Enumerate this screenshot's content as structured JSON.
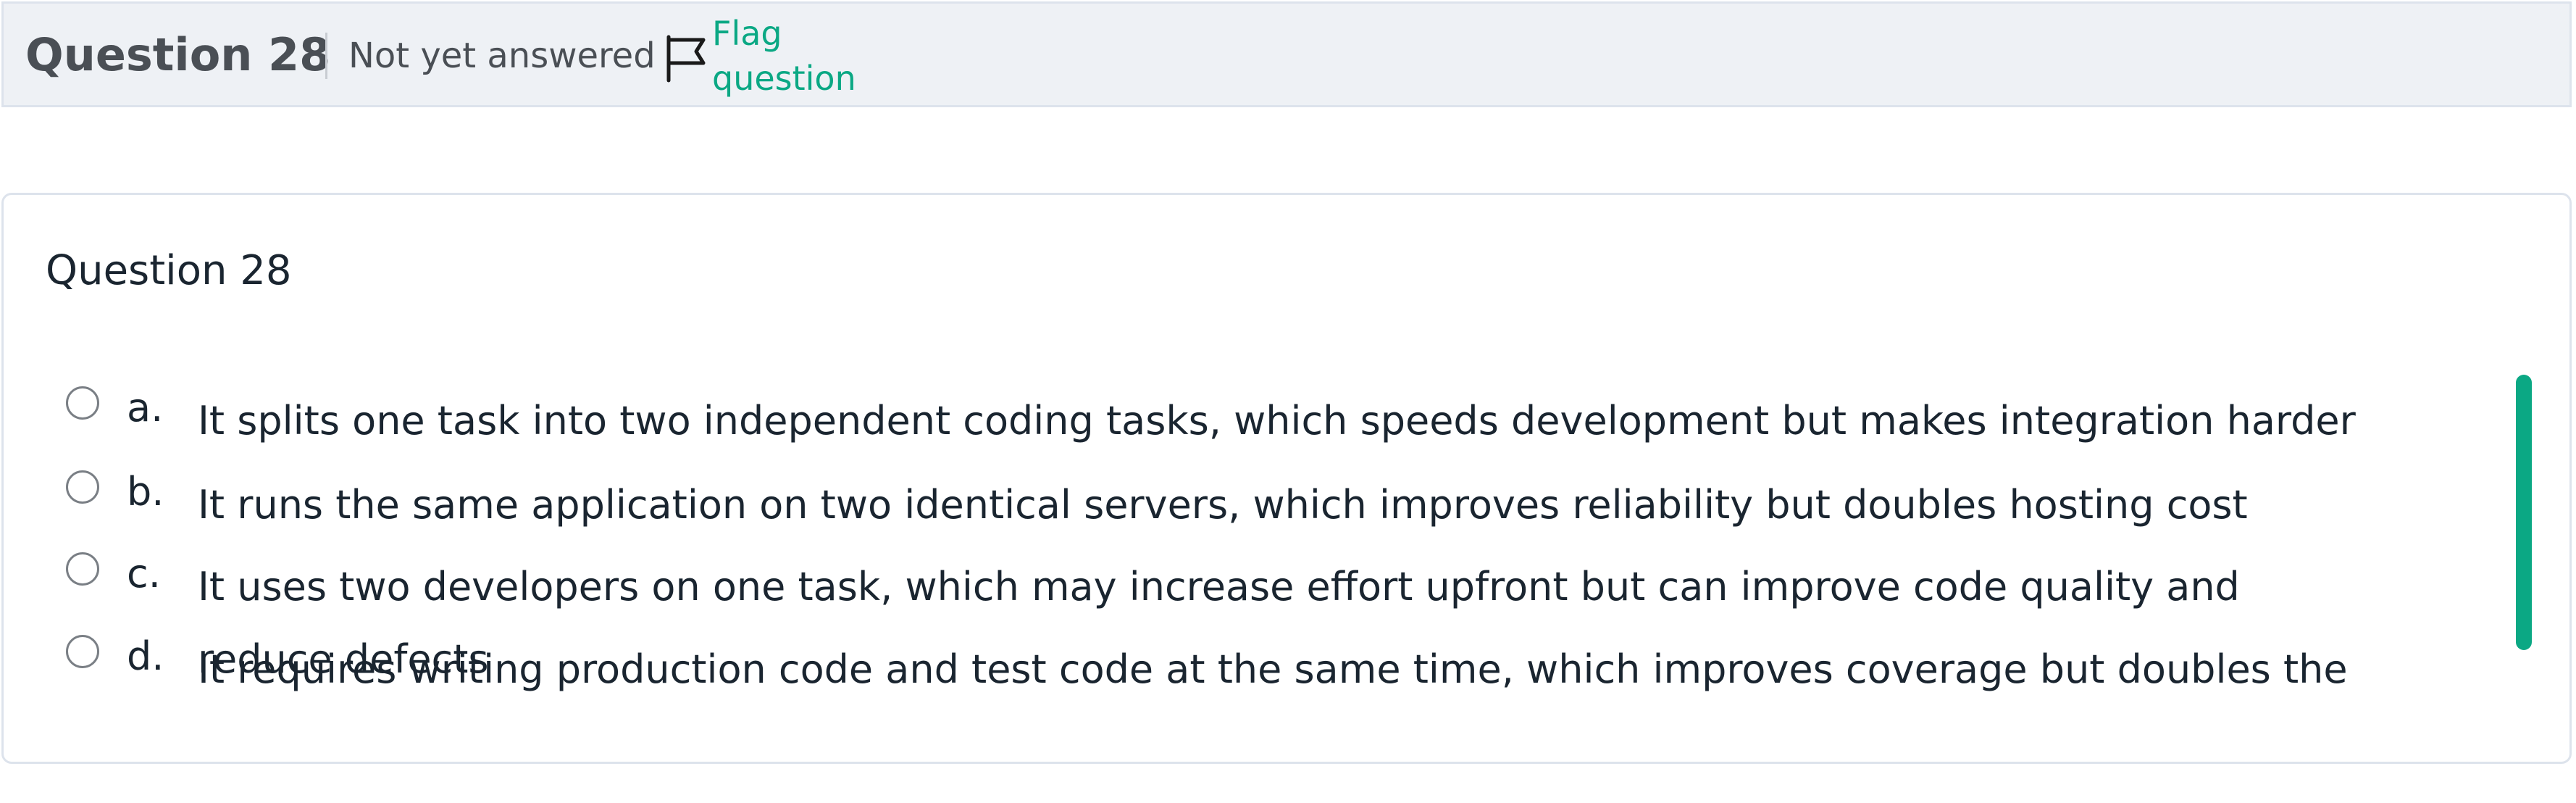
{
  "header": {
    "question_title": "Question 28",
    "state": "Not yet answered",
    "flag_label": "Flag question"
  },
  "question": {
    "title": "Question 28",
    "options": [
      {
        "letter": "a.",
        "text": "It splits one task into two independent coding tasks, which speeds development but makes integration harder"
      },
      {
        "letter": "b.",
        "text": "It runs the same application on two identical servers, which improves reliability but doubles hosting cost"
      },
      {
        "letter": "c.",
        "text": "It uses two developers on one task, which may increase effort upfront but can improve code quality and reduce defects"
      },
      {
        "letter": "d.",
        "text": "It requires writing production code and test code at the same time, which improves coverage but doubles the"
      }
    ]
  },
  "colors": {
    "accent": "#0ba884",
    "header_bg": "#eef1f5",
    "border": "#dde3ec",
    "text": "#1a2530"
  },
  "icons": {
    "flag": "flag-icon"
  }
}
